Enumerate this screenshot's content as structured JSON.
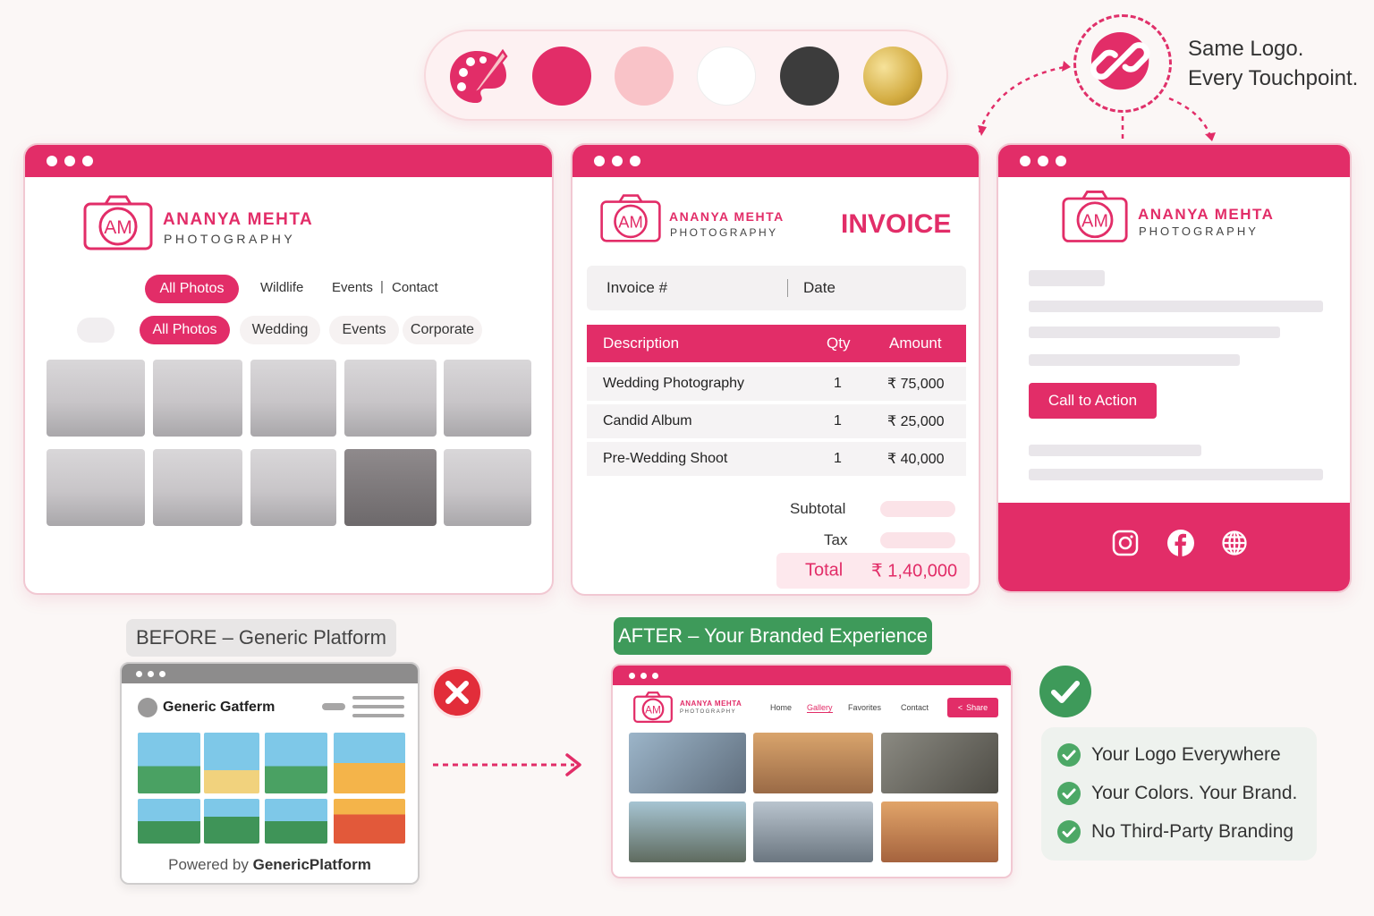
{
  "palette": {
    "icon": "paint-palette-icon",
    "colors": [
      "#e22d68",
      "#f9c3c8",
      "#ffffff",
      "#3c3c3c",
      "#d4ad43"
    ]
  },
  "link_badge": {
    "icon": "chain-link-icon"
  },
  "tagline": {
    "line1": "Same Logo.",
    "line2": "Every Touchpoint."
  },
  "brand": {
    "monogram": "AM",
    "name": "ANANYA MEHTA",
    "sub": "PHOTOGRAPHY"
  },
  "portfolio": {
    "top_nav": [
      "All Photos",
      "Wildlife",
      "Events",
      "Contact"
    ],
    "filters": [
      "All Photos",
      "Wedding",
      "Events",
      "Corporate"
    ]
  },
  "invoice": {
    "title": "INVOICE",
    "meta": {
      "number_label": "Invoice #",
      "date_label": "Date"
    },
    "columns": [
      "Description",
      "Qty",
      "Amount"
    ],
    "rows": [
      {
        "description": "Wedding Photography",
        "qty": "1",
        "amount": "₹ 75,000"
      },
      {
        "description": "Candid Album",
        "qty": "1",
        "amount": "₹ 25,000"
      },
      {
        "description": "Pre-Wedding Shoot",
        "qty": "1",
        "amount": "₹ 40,000"
      }
    ],
    "subtotal_label": "Subtotal",
    "tax_label": "Tax",
    "total_label": "Total",
    "total_value": "₹ 1,40,000"
  },
  "email": {
    "cta": "Call to Action",
    "social_icons": [
      "instagram-icon",
      "facebook-icon",
      "globe-icon"
    ]
  },
  "before": {
    "tag": "BEFORE – Generic Platform",
    "platform_name": "Generic Gatferm",
    "footer_prefix": "Powered by ",
    "footer_brand": "GenericPlatform"
  },
  "after": {
    "tag": "AFTER – Your Branded Experience",
    "brand_name": "ANANYA MEHTA",
    "brand_sub": "PHOTOGRAPHY",
    "nav": [
      "Home",
      "Gallery",
      "Favorites",
      "Contact"
    ],
    "share": "Share"
  },
  "benefits": [
    "Your Logo Everywhere",
    "Your Colors. Your Brand.",
    "No Third-Party Branding"
  ]
}
